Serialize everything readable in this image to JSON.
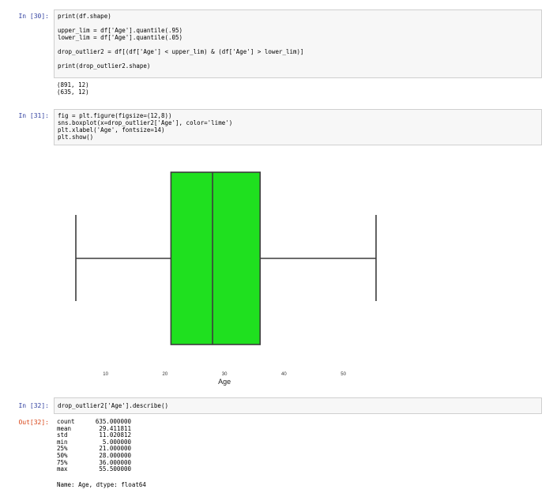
{
  "cells": [
    {
      "prompt": "In [30]:",
      "code": [
        "print(df.shape)",
        "",
        "upper_lim = df['Age'].quantile(.95)",
        "lower_lim = df['Age'].quantile(.05)",
        "",
        "drop_outlier2 = df[(df['Age'] < upper_lim) & (df['Age'] > lower_lim)]",
        "",
        "print(drop_outlier2.shape)"
      ],
      "output": [
        "(891, 12)",
        "(635, 12)"
      ]
    },
    {
      "prompt": "In [31]:",
      "code": [
        "fig = plt.figure(figsize=(12,8))",
        "sns.boxplot(x=drop_outlier2['Age'], color='lime')",
        "plt.xlabel('Age', fontsize=14)",
        "plt.show()"
      ]
    },
    {
      "prompt": "In [32]:",
      "code": [
        "drop_outlier2['Age'].describe()"
      ],
      "out_prompt": "Out[32]:",
      "describe": [
        {
          "label": "count",
          "value": "635.000000"
        },
        {
          "label": "mean",
          "value": "29.411811"
        },
        {
          "label": "std",
          "value": "11.020812"
        },
        {
          "label": "min",
          "value": "5.000000"
        },
        {
          "label": "25%",
          "value": "21.000000"
        },
        {
          "label": "50%",
          "value": "28.000000"
        },
        {
          "label": "75%",
          "value": "36.000000"
        },
        {
          "label": "max",
          "value": "55.500000"
        }
      ],
      "dtype_line": "Name: Age, dtype: float64"
    }
  ],
  "chart_data": {
    "type": "boxplot",
    "xlabel": "Age",
    "xticks": [
      10,
      20,
      30,
      40,
      50
    ],
    "xlim": [
      2.5,
      58.0
    ],
    "whisker_low": 5.0,
    "q1": 21.0,
    "median": 28.0,
    "q3": 36.0,
    "whisker_high": 55.5,
    "box_color": "#1fe01f",
    "edge_color": "#3c3c3c"
  }
}
